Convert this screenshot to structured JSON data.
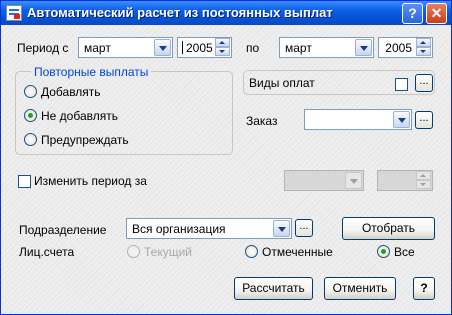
{
  "window": {
    "title": "Автоматический расчет из постоянных выплат",
    "help_button": "?",
    "close_button": "✕"
  },
  "period": {
    "from_label": "Период с",
    "from_month": "март",
    "from_year": "2005",
    "to_label": "по",
    "to_month": "март",
    "to_year": "2005"
  },
  "repeat_group": {
    "title": "Повторные выплаты",
    "options": [
      {
        "label": "Добавлять",
        "checked": false
      },
      {
        "label": "Не добавлять",
        "checked": true
      },
      {
        "label": "Предупреждать",
        "checked": false
      }
    ]
  },
  "payment_types": {
    "label": "Виды оплат",
    "dots": "..."
  },
  "order": {
    "label": "Заказ",
    "value": "",
    "dots": "..."
  },
  "change_period": {
    "label": "Изменить период за",
    "checked": false
  },
  "department": {
    "label": "Подразделение",
    "value": "Вся организация",
    "dots": "...",
    "select_button": "Отобрать"
  },
  "accounts": {
    "label": "Лиц.счета",
    "options": [
      {
        "label": "Текущий",
        "checked": false,
        "enabled": false
      },
      {
        "label": "Отмеченные",
        "checked": false,
        "enabled": true
      },
      {
        "label": "Все",
        "checked": true,
        "enabled": true
      }
    ]
  },
  "footer": {
    "calculate_button": "Рассчитать",
    "cancel_button": "Отменить",
    "help_button": "?"
  }
}
